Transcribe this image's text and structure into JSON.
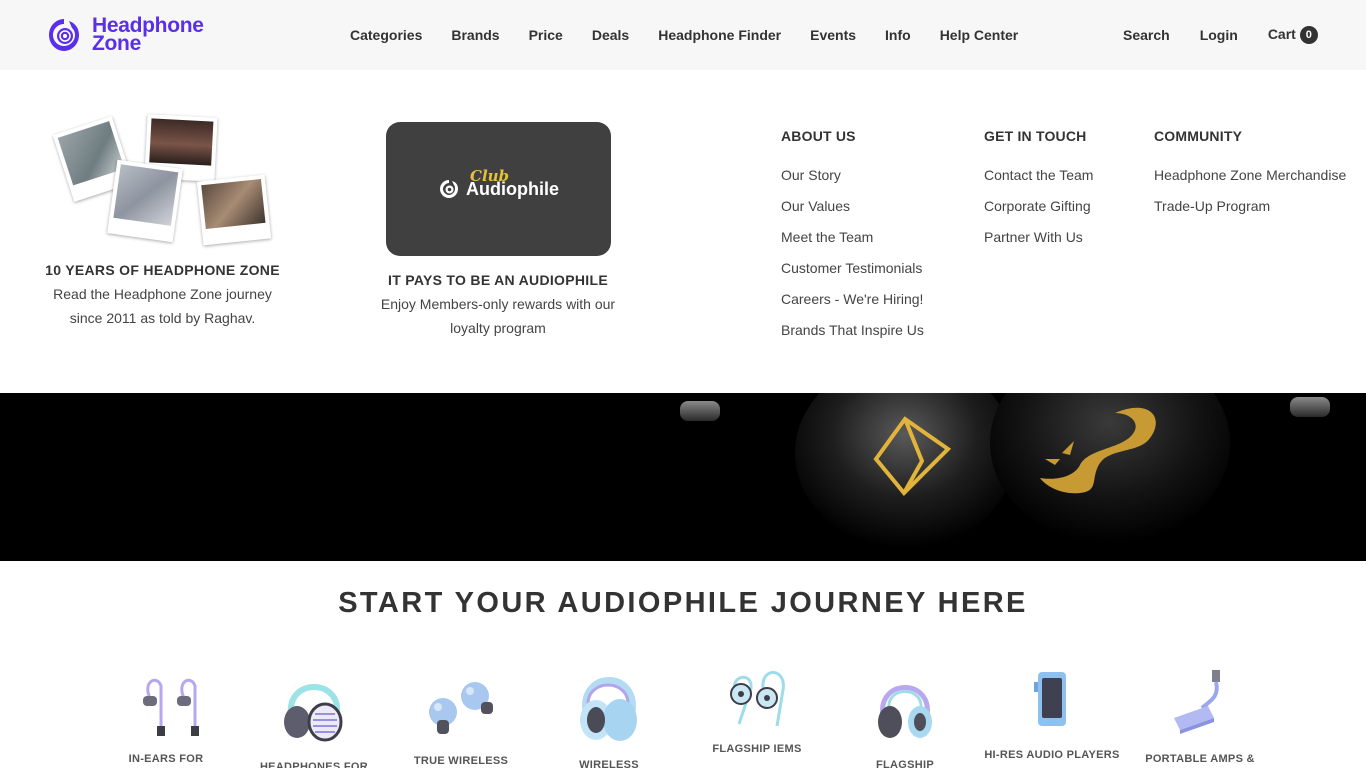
{
  "header": {
    "logo": {
      "line1": "Headphone",
      "line2": "Zone",
      "icon": "headphone-zone-logo-icon",
      "brand_color": "#5a2fe8"
    },
    "nav": [
      "Categories",
      "Brands",
      "Price",
      "Deals",
      "Headphone Finder",
      "Events",
      "Info",
      "Help Center"
    ],
    "search_label": "Search",
    "login_label": "Login",
    "cart_label": "Cart",
    "cart_count": "0"
  },
  "mega_menu": {
    "story_feature": {
      "title": "10 YEARS OF HEADPHONE ZONE",
      "description": "Read the Headphone Zone journey since 2011 as told by Raghav."
    },
    "club_feature": {
      "script": "Club",
      "name": "Audiophile",
      "title": "IT PAYS TO BE AN AUDIOPHILE",
      "description": "Enjoy Members-only rewards with our loyalty program"
    },
    "about": {
      "heading": "ABOUT US",
      "links": [
        "Our Story",
        "Our Values",
        "Meet the Team",
        "Customer Testimonials",
        "Careers - We're Hiring!",
        "Brands That Inspire Us"
      ]
    },
    "touch": {
      "heading": "GET IN TOUCH",
      "links": [
        "Contact the Team",
        "Corporate Gifting",
        "Partner With Us"
      ]
    },
    "community": {
      "heading": "COMMUNITY",
      "links": [
        "Headphone Zone Merchandise",
        "Trade-Up Program"
      ]
    }
  },
  "journey": {
    "title": "START YOUR AUDIOPHILE JOURNEY HERE",
    "categories": [
      {
        "label": "IN-EARS FOR",
        "icon": "in-ear-earphones-icon"
      },
      {
        "label": "HEADPHONES FOR",
        "icon": "over-ear-headphones-icon"
      },
      {
        "label": "TRUE WIRELESS",
        "icon": "true-wireless-earbuds-icon"
      },
      {
        "label": "WIRELESS",
        "icon": "wireless-headphones-icon"
      },
      {
        "label": "FLAGSHIP IEMS",
        "icon": "flagship-iem-icon"
      },
      {
        "label": "FLAGSHIP",
        "icon": "flagship-headphones-icon"
      },
      {
        "label": "HI-RES AUDIO PLAYERS",
        "icon": "audio-player-icon"
      },
      {
        "label": "PORTABLE AMPS &",
        "icon": "portable-amp-icon"
      }
    ]
  }
}
